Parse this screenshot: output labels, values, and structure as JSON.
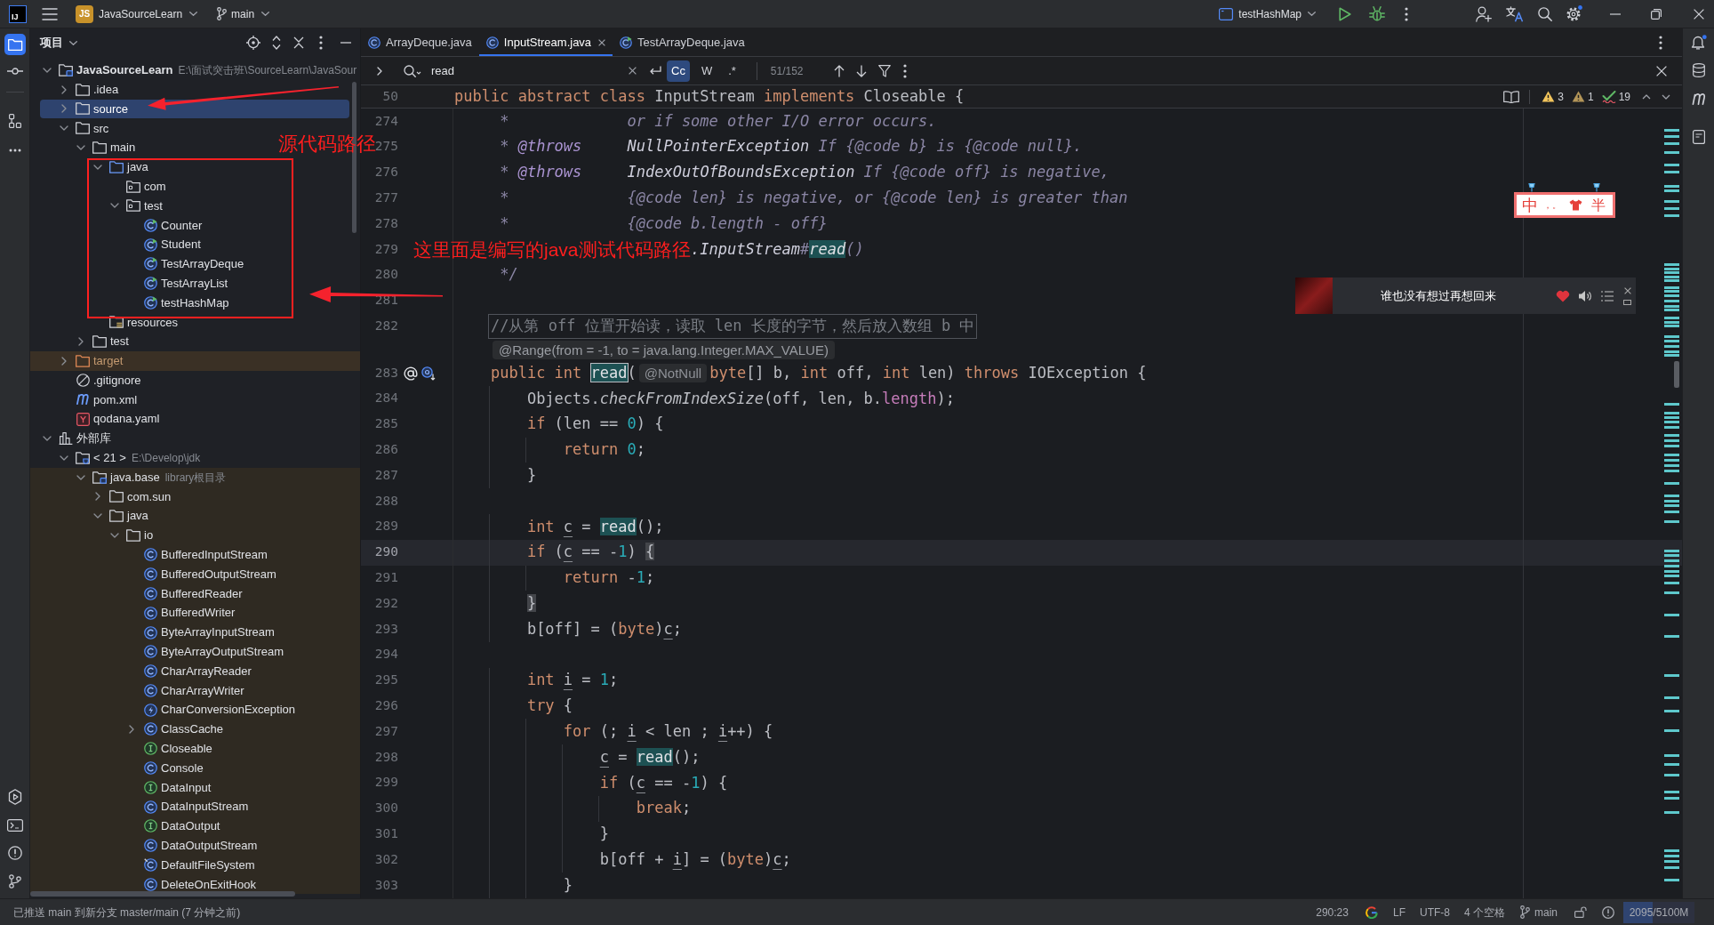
{
  "title_bar": {
    "logo": "IJ",
    "project_badge": "JS",
    "project": "JavaSourceLearn",
    "branch": "main",
    "run_configuration": "testHashMap",
    "settings_badge": true
  },
  "tool_strip_left": {
    "top": [
      {
        "kind": "project",
        "selected": true
      },
      {
        "kind": "commit",
        "selected": false
      },
      {
        "kind": "structure",
        "selected": false
      },
      {
        "kind": "more",
        "selected": false
      }
    ],
    "bottom": [
      {
        "kind": "services",
        "selected": false
      },
      {
        "kind": "terminal",
        "selected": false
      },
      {
        "kind": "problems",
        "selected": false
      },
      {
        "kind": "git",
        "selected": false
      }
    ]
  },
  "tool_strip_right": {
    "notifications_badge": true
  },
  "project_panel": {
    "title": "项目",
    "tree": [
      {
        "label": "JavaSourceLearn",
        "kind": "project",
        "hint": "E:\\面试突击班\\SourceLearn\\JavaSour",
        "expanded": true,
        "selected": false,
        "children": [
          {
            "label": ".idea",
            "kind": "folder",
            "expanded": false,
            "selected": false
          },
          {
            "label": "source",
            "kind": "folder",
            "expanded": false,
            "selected": true
          },
          {
            "label": "src",
            "kind": "folder",
            "expanded": true,
            "selected": false,
            "children": [
              {
                "label": "main",
                "kind": "folder",
                "expanded": true,
                "selected": false,
                "children": [
                  {
                    "label": "java",
                    "kind": "source-folder",
                    "expanded": true,
                    "selected": false,
                    "children": [
                      {
                        "label": "com",
                        "kind": "package",
                        "selected": false
                      },
                      {
                        "label": "test",
                        "kind": "package",
                        "expanded": true,
                        "selected": false,
                        "children": [
                          {
                            "label": "Counter",
                            "kind": "runnable-class",
                            "selected": false
                          },
                          {
                            "label": "Student",
                            "kind": "runnable-class",
                            "selected": false
                          },
                          {
                            "label": "TestArrayDeque",
                            "kind": "runnable-class",
                            "selected": false
                          },
                          {
                            "label": "TestArrayList",
                            "kind": "runnable-class",
                            "selected": false
                          },
                          {
                            "label": "testHashMap",
                            "kind": "runnable-class",
                            "selected": false
                          }
                        ]
                      }
                    ]
                  },
                  {
                    "label": "resources",
                    "kind": "resources-folder",
                    "selected": false
                  }
                ]
              },
              {
                "label": "test",
                "kind": "folder",
                "expanded": false,
                "selected": false
              }
            ]
          },
          {
            "label": "target",
            "kind": "excluded-folder",
            "expanded": false,
            "selected": false
          },
          {
            "label": ".gitignore",
            "kind": "ignore-file",
            "selected": false
          },
          {
            "label": "pom.xml",
            "kind": "maven-file",
            "selected": false
          },
          {
            "label": "qodana.yaml",
            "kind": "yaml-file",
            "selected": false
          }
        ]
      },
      {
        "label": "外部库",
        "kind": "libraries",
        "expanded": true,
        "selected": false,
        "children": [
          {
            "label": "< 21 >",
            "kind": "sdk",
            "hint": "E:\\Develop\\jdk",
            "expanded": true,
            "selected": false,
            "children": [
              {
                "label": "java.base",
                "kind": "library-root",
                "hint": "library根目录",
                "expanded": true,
                "selected": false,
                "children": [
                  {
                    "label": "com.sun",
                    "kind": "folder",
                    "expanded": false,
                    "selected": false
                  },
                  {
                    "label": "java",
                    "kind": "folder",
                    "expanded": true,
                    "selected": false,
                    "children": [
                      {
                        "label": "io",
                        "kind": "folder",
                        "expanded": true,
                        "selected": false,
                        "children": [
                          {
                            "label": "BufferedInputStream",
                            "kind": "class",
                            "selected": false
                          },
                          {
                            "label": "BufferedOutputStream",
                            "kind": "class",
                            "selected": false
                          },
                          {
                            "label": "BufferedReader",
                            "kind": "class",
                            "selected": false
                          },
                          {
                            "label": "BufferedWriter",
                            "kind": "class",
                            "selected": false
                          },
                          {
                            "label": "ByteArrayInputStream",
                            "kind": "class",
                            "selected": false
                          },
                          {
                            "label": "ByteArrayOutputStream",
                            "kind": "class",
                            "selected": false
                          },
                          {
                            "label": "CharArrayReader",
                            "kind": "class",
                            "selected": false
                          },
                          {
                            "label": "CharArrayWriter",
                            "kind": "class",
                            "selected": false
                          },
                          {
                            "label": "CharConversionException",
                            "kind": "exception",
                            "selected": false
                          },
                          {
                            "label": "ClassCache",
                            "kind": "class",
                            "expanded": false,
                            "selected": false
                          },
                          {
                            "label": "Closeable",
                            "kind": "interface",
                            "selected": false
                          },
                          {
                            "label": "Console",
                            "kind": "class",
                            "selected": false
                          },
                          {
                            "label": "DataInput",
                            "kind": "interface",
                            "selected": false
                          },
                          {
                            "label": "DataInputStream",
                            "kind": "class",
                            "selected": false
                          },
                          {
                            "label": "DataOutput",
                            "kind": "interface",
                            "selected": false
                          },
                          {
                            "label": "DataOutputStream",
                            "kind": "class",
                            "selected": false
                          },
                          {
                            "label": "DefaultFileSystem",
                            "kind": "class-marked",
                            "selected": false
                          },
                          {
                            "label": "DeleteOnExitHook",
                            "kind": "class",
                            "selected": false
                          }
                        ]
                      }
                    ]
                  }
                ]
              }
            ]
          }
        ]
      }
    ]
  },
  "editor": {
    "tabs": [
      {
        "label": "ArrayDeque.java",
        "kind": "class",
        "selected": false
      },
      {
        "label": "InputStream.java",
        "kind": "class",
        "selected": true
      },
      {
        "label": "TestArrayDeque.java",
        "kind": "runnable-class",
        "selected": false
      }
    ],
    "find": {
      "value": "read",
      "options": [
        {
          "label": "Cc",
          "selected": true
        },
        {
          "label": "W",
          "selected": false
        },
        {
          "label": ".*",
          "selected": false
        }
      ],
      "match_count": "51/152"
    },
    "inspections": [
      {
        "kind": "warning",
        "count": "3"
      },
      {
        "kind": "weak-warning",
        "count": "1"
      },
      {
        "kind": "typo",
        "count": "19"
      }
    ],
    "sticky_line": {
      "number": "50",
      "tokens": [
        {
          "text": "public abstract class",
          "kind": "keyword"
        },
        {
          "text": " InputStream ",
          "kind": "plain"
        },
        {
          "text": "implements",
          "kind": "keyword"
        },
        {
          "text": " Closeable {",
          "kind": "plain"
        }
      ]
    },
    "lines": [
      {
        "number": "274",
        "kind": "doc",
        "current": false,
        "tokens": [
          {
            "text": "     *             or if some other I/O error occurs.",
            "kind": "doc"
          }
        ]
      },
      {
        "number": "275",
        "kind": "doc",
        "current": false,
        "tokens": [
          {
            "text": "     * ",
            "kind": "doc"
          },
          {
            "text": "@throws",
            "kind": "doc-tag"
          },
          {
            "text": "     NullPointerException",
            "kind": "doc-ref"
          },
          {
            "text": " If {@code b} is {@code null}.",
            "kind": "doc"
          }
        ]
      },
      {
        "number": "276",
        "kind": "doc",
        "current": false,
        "tokens": [
          {
            "text": "     * ",
            "kind": "doc"
          },
          {
            "text": "@throws",
            "kind": "doc-tag"
          },
          {
            "text": "     IndexOutOfBoundsException",
            "kind": "doc-ref"
          },
          {
            "text": " If {@code off} is negative,",
            "kind": "doc"
          }
        ]
      },
      {
        "number": "277",
        "kind": "doc",
        "current": false,
        "tokens": [
          {
            "text": "     *             {@code len} is negative, or {@code len} is greater than",
            "kind": "doc"
          }
        ]
      },
      {
        "number": "278",
        "kind": "doc",
        "current": false,
        "tokens": [
          {
            "text": "     *             {@code b.length - off}",
            "kind": "doc"
          }
        ]
      },
      {
        "number": "279",
        "kind": "doc",
        "current": false,
        "tokens": [
          {
            "text": "                          .InputStream",
            "kind": "doc-ref"
          },
          {
            "text": "#",
            "kind": "doc"
          },
          {
            "text": "read",
            "kind": "match"
          },
          {
            "text": "()",
            "kind": "doc"
          }
        ]
      },
      {
        "number": "280",
        "kind": "doc",
        "current": false,
        "tokens": [
          {
            "text": "     */",
            "kind": "doc"
          }
        ]
      },
      {
        "number": "281",
        "kind": "code",
        "current": false
      },
      {
        "number": "282",
        "kind": "code",
        "current": false,
        "boxed": true,
        "tokens": [
          {
            "text": "    //从第 off 位置开始读，读取 len 长度的字节，然后放入数组 b 中",
            "kind": "comment"
          }
        ]
      },
      {
        "kind": "inlay",
        "text": "    @Range(from = -1, to = java.lang.Integer.MAX_VALUE)"
      },
      {
        "number": "283",
        "kind": "code",
        "current": false,
        "gutter": [
          {
            "kind": "annotation"
          },
          {
            "kind": "implementation"
          }
        ],
        "tokens": [
          {
            "text": "    public int ",
            "kind": "keyword"
          },
          {
            "text": "read",
            "kind": "match-current"
          },
          {
            "text": "(",
            "kind": "plain"
          },
          {
            "text": "@NotNull",
            "kind": "hint"
          },
          {
            "text": "byte",
            "kind": "keyword"
          },
          {
            "text": "[] b, ",
            "kind": "plain"
          },
          {
            "text": "int",
            "kind": "keyword"
          },
          {
            "text": " off, ",
            "kind": "plain"
          },
          {
            "text": "int",
            "kind": "keyword"
          },
          {
            "text": " len) ",
            "kind": "plain"
          },
          {
            "text": "throws",
            "kind": "keyword"
          },
          {
            "text": " IOException {",
            "kind": "plain"
          }
        ]
      },
      {
        "number": "284",
        "kind": "code",
        "current": false,
        "tokens": [
          {
            "text": "        Objects.",
            "kind": "plain"
          },
          {
            "text": "checkFromIndexSize",
            "kind": "static"
          },
          {
            "text": "(off, len, b.",
            "kind": "plain"
          },
          {
            "text": "length",
            "kind": "field"
          },
          {
            "text": ");",
            "kind": "plain"
          }
        ]
      },
      {
        "number": "285",
        "kind": "code",
        "current": false,
        "tokens": [
          {
            "text": "        if",
            "kind": "keyword"
          },
          {
            "text": " (len == ",
            "kind": "plain"
          },
          {
            "text": "0",
            "kind": "number"
          },
          {
            "text": ") {",
            "kind": "plain"
          }
        ]
      },
      {
        "number": "286",
        "kind": "code",
        "current": false,
        "tokens": [
          {
            "text": "            return ",
            "kind": "keyword"
          },
          {
            "text": "0",
            "kind": "number"
          },
          {
            "text": ";",
            "kind": "plain"
          }
        ]
      },
      {
        "number": "287",
        "kind": "code",
        "current": false,
        "tokens": [
          {
            "text": "        }",
            "kind": "plain"
          }
        ]
      },
      {
        "number": "288",
        "kind": "code",
        "current": false
      },
      {
        "number": "289",
        "kind": "code",
        "current": false,
        "tokens": [
          {
            "text": "        int ",
            "kind": "keyword"
          },
          {
            "text": "c",
            "kind": "variable"
          },
          {
            "text": " = ",
            "kind": "plain"
          },
          {
            "text": "read",
            "kind": "match"
          },
          {
            "text": "();",
            "kind": "plain"
          }
        ]
      },
      {
        "number": "290",
        "kind": "code",
        "current": true,
        "tokens": [
          {
            "text": "        if",
            "kind": "keyword"
          },
          {
            "text": " (",
            "kind": "plain"
          },
          {
            "text": "c",
            "kind": "variable"
          },
          {
            "text": " == -",
            "kind": "plain"
          },
          {
            "text": "1",
            "kind": "number"
          },
          {
            "text": ") ",
            "kind": "plain"
          },
          {
            "text": "{",
            "kind": "brace"
          }
        ]
      },
      {
        "number": "291",
        "kind": "code",
        "current": false,
        "tokens": [
          {
            "text": "            return",
            "kind": "keyword"
          },
          {
            "text": " -",
            "kind": "plain"
          },
          {
            "text": "1",
            "kind": "number"
          },
          {
            "text": ";",
            "kind": "plain"
          }
        ]
      },
      {
        "number": "292",
        "kind": "code",
        "current": false,
        "tokens": [
          {
            "text": "        }",
            "kind": "brace"
          }
        ]
      },
      {
        "number": "293",
        "kind": "code",
        "current": false,
        "tokens": [
          {
            "text": "        b[off] = (",
            "kind": "plain"
          },
          {
            "text": "byte",
            "kind": "keyword"
          },
          {
            "text": ")",
            "kind": "plain"
          },
          {
            "text": "c",
            "kind": "variable"
          },
          {
            "text": ";",
            "kind": "plain"
          }
        ]
      },
      {
        "number": "294",
        "kind": "code",
        "current": false
      },
      {
        "number": "295",
        "kind": "code",
        "current": false,
        "tokens": [
          {
            "text": "        int ",
            "kind": "keyword"
          },
          {
            "text": "i",
            "kind": "variable"
          },
          {
            "text": " = ",
            "kind": "plain"
          },
          {
            "text": "1",
            "kind": "number"
          },
          {
            "text": ";",
            "kind": "plain"
          }
        ]
      },
      {
        "number": "296",
        "kind": "code",
        "current": false,
        "tokens": [
          {
            "text": "        try",
            "kind": "keyword"
          },
          {
            "text": " {",
            "kind": "plain"
          }
        ]
      },
      {
        "number": "297",
        "kind": "code",
        "current": false,
        "tokens": [
          {
            "text": "            for",
            "kind": "keyword"
          },
          {
            "text": " (; ",
            "kind": "plain"
          },
          {
            "text": "i",
            "kind": "variable"
          },
          {
            "text": " < len ; ",
            "kind": "plain"
          },
          {
            "text": "i",
            "kind": "variable"
          },
          {
            "text": "++) {",
            "kind": "plain"
          }
        ]
      },
      {
        "number": "298",
        "kind": "code",
        "current": false,
        "tokens": [
          {
            "text": "                c",
            "kind": "variable"
          },
          {
            "text": " = ",
            "kind": "plain"
          },
          {
            "text": "read",
            "kind": "match"
          },
          {
            "text": "();",
            "kind": "plain"
          }
        ]
      },
      {
        "number": "299",
        "kind": "code",
        "current": false,
        "tokens": [
          {
            "text": "                if",
            "kind": "keyword"
          },
          {
            "text": " (",
            "kind": "plain"
          },
          {
            "text": "c",
            "kind": "variable"
          },
          {
            "text": " == -",
            "kind": "plain"
          },
          {
            "text": "1",
            "kind": "number"
          },
          {
            "text": ") {",
            "kind": "plain"
          }
        ]
      },
      {
        "number": "300",
        "kind": "code",
        "current": false,
        "tokens": [
          {
            "text": "                    break",
            "kind": "keyword"
          },
          {
            "text": ";",
            "kind": "plain"
          }
        ]
      },
      {
        "number": "301",
        "kind": "code",
        "current": false,
        "tokens": [
          {
            "text": "                }",
            "kind": "plain"
          }
        ]
      },
      {
        "number": "302",
        "kind": "code",
        "current": false,
        "tokens": [
          {
            "text": "                b[off + ",
            "kind": "plain"
          },
          {
            "text": "i",
            "kind": "variable"
          },
          {
            "text": "] = (",
            "kind": "plain"
          },
          {
            "text": "byte",
            "kind": "keyword"
          },
          {
            "text": ")",
            "kind": "plain"
          },
          {
            "text": "c",
            "kind": "variable"
          },
          {
            "text": ";",
            "kind": "plain"
          }
        ]
      },
      {
        "number": "303",
        "kind": "code",
        "current": false,
        "tokens": [
          {
            "text": "            }",
            "kind": "plain"
          }
        ]
      }
    ]
  },
  "annotations": [
    {
      "kind": "arrow"
    },
    {
      "kind": "label",
      "text": "源代码路径"
    },
    {
      "kind": "box"
    },
    {
      "kind": "arrow"
    },
    {
      "kind": "label",
      "text": "这里面是编写的java测试代码路径"
    }
  ],
  "ime_toolbar": {
    "mode": "中",
    "punctuation": "，。",
    "width": "半"
  },
  "music_player": {
    "title": "谁也没有想过再想回来",
    "liked": true
  },
  "status_bar": {
    "message": "已推送 main 到新分支 master/main (7 分钟之前)",
    "position": "290:23",
    "line_separator": "LF",
    "encoding": "UTF-8",
    "indent": "4 个空格",
    "branch": "main",
    "memory": {
      "text": "2095/5100M",
      "level": 0.41
    }
  }
}
